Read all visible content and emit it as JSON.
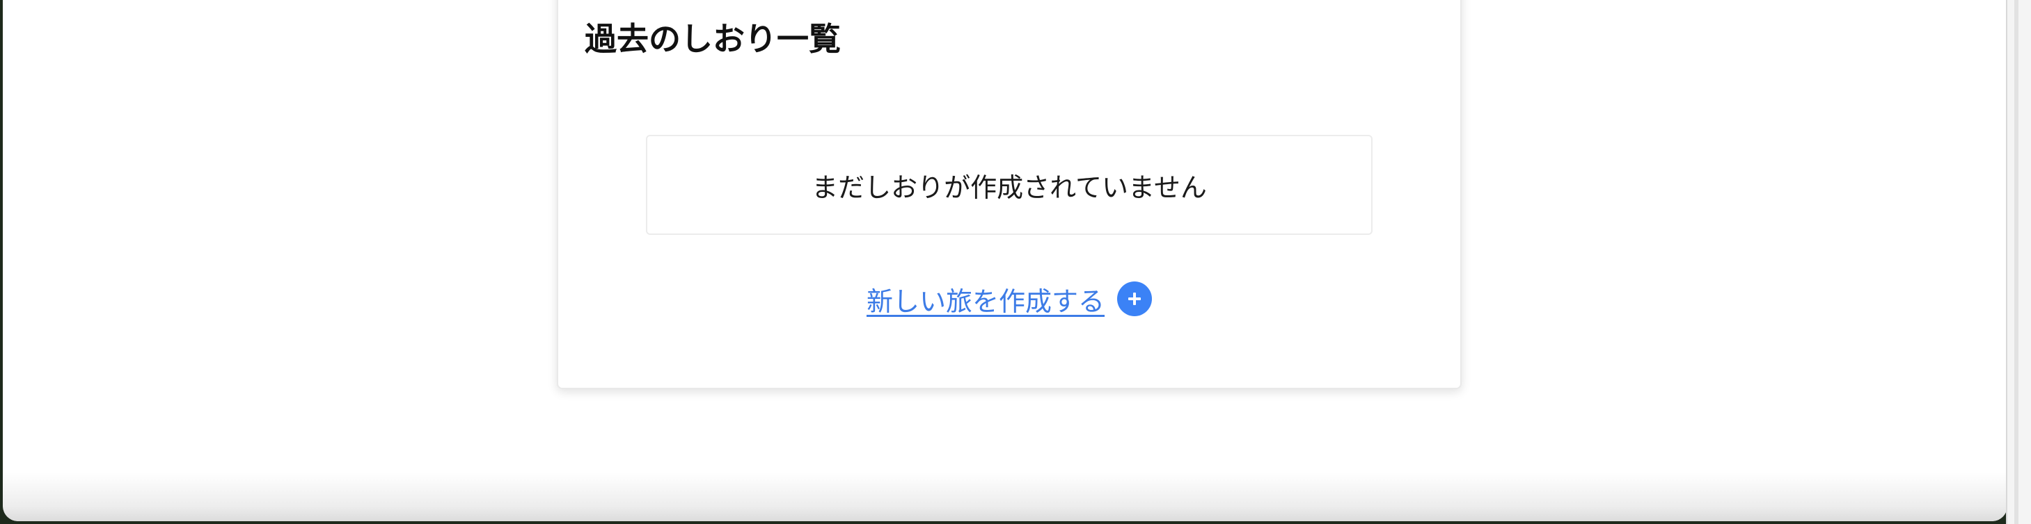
{
  "history": {
    "title": "過去のしおり一覧",
    "empty_message": "まだしおりが作成されていません",
    "create_link_label": "新しい旅を作成する",
    "create_icon": "plus-circle-icon"
  },
  "colors": {
    "link": "#3c7be6",
    "accent": "#3b82f6",
    "text": "#111111",
    "card_border": "#e9e9e9"
  }
}
